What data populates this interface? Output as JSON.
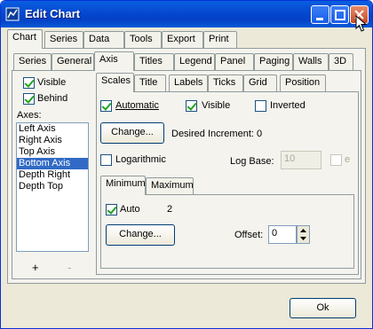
{
  "window": {
    "title": "Edit Chart"
  },
  "tabs_main": [
    "Chart",
    "Series",
    "Data",
    "Tools",
    "Export",
    "Print"
  ],
  "tabs_chart": [
    "Series",
    "General",
    "Axis",
    "Titles",
    "Legend",
    "Panel",
    "Paging",
    "Walls",
    "3D"
  ],
  "left_panel": {
    "visible_label": "Visible",
    "behind_label": "Behind",
    "axes_label": "Axes:",
    "axes": [
      "Left Axis",
      "Right Axis",
      "Top Axis",
      "Bottom Axis",
      "Depth Right",
      "Depth Top"
    ],
    "selected_axis": "Bottom Axis",
    "add_label": "+",
    "remove_label": "-"
  },
  "tabs_axis": [
    "Scales",
    "Title",
    "Labels",
    "Ticks",
    "Grid",
    "Position"
  ],
  "scales": {
    "automatic_label": "Automatic",
    "visible_label": "Visible",
    "inverted_label": "Inverted",
    "change_label": "Change...",
    "desired_increment_label": "Desired Increment: 0",
    "logarithmic_label": "Logarithmic",
    "log_base_label": "Log Base:",
    "log_base_value": "10",
    "e_label": "e"
  },
  "tabs_minmax": [
    "Minimum",
    "Maximum"
  ],
  "minimum": {
    "auto_label": "Auto",
    "auto_value": "2",
    "change_label": "Change...",
    "offset_label": "Offset:",
    "offset_value": "0"
  },
  "footer": {
    "ok_label": "Ok"
  }
}
